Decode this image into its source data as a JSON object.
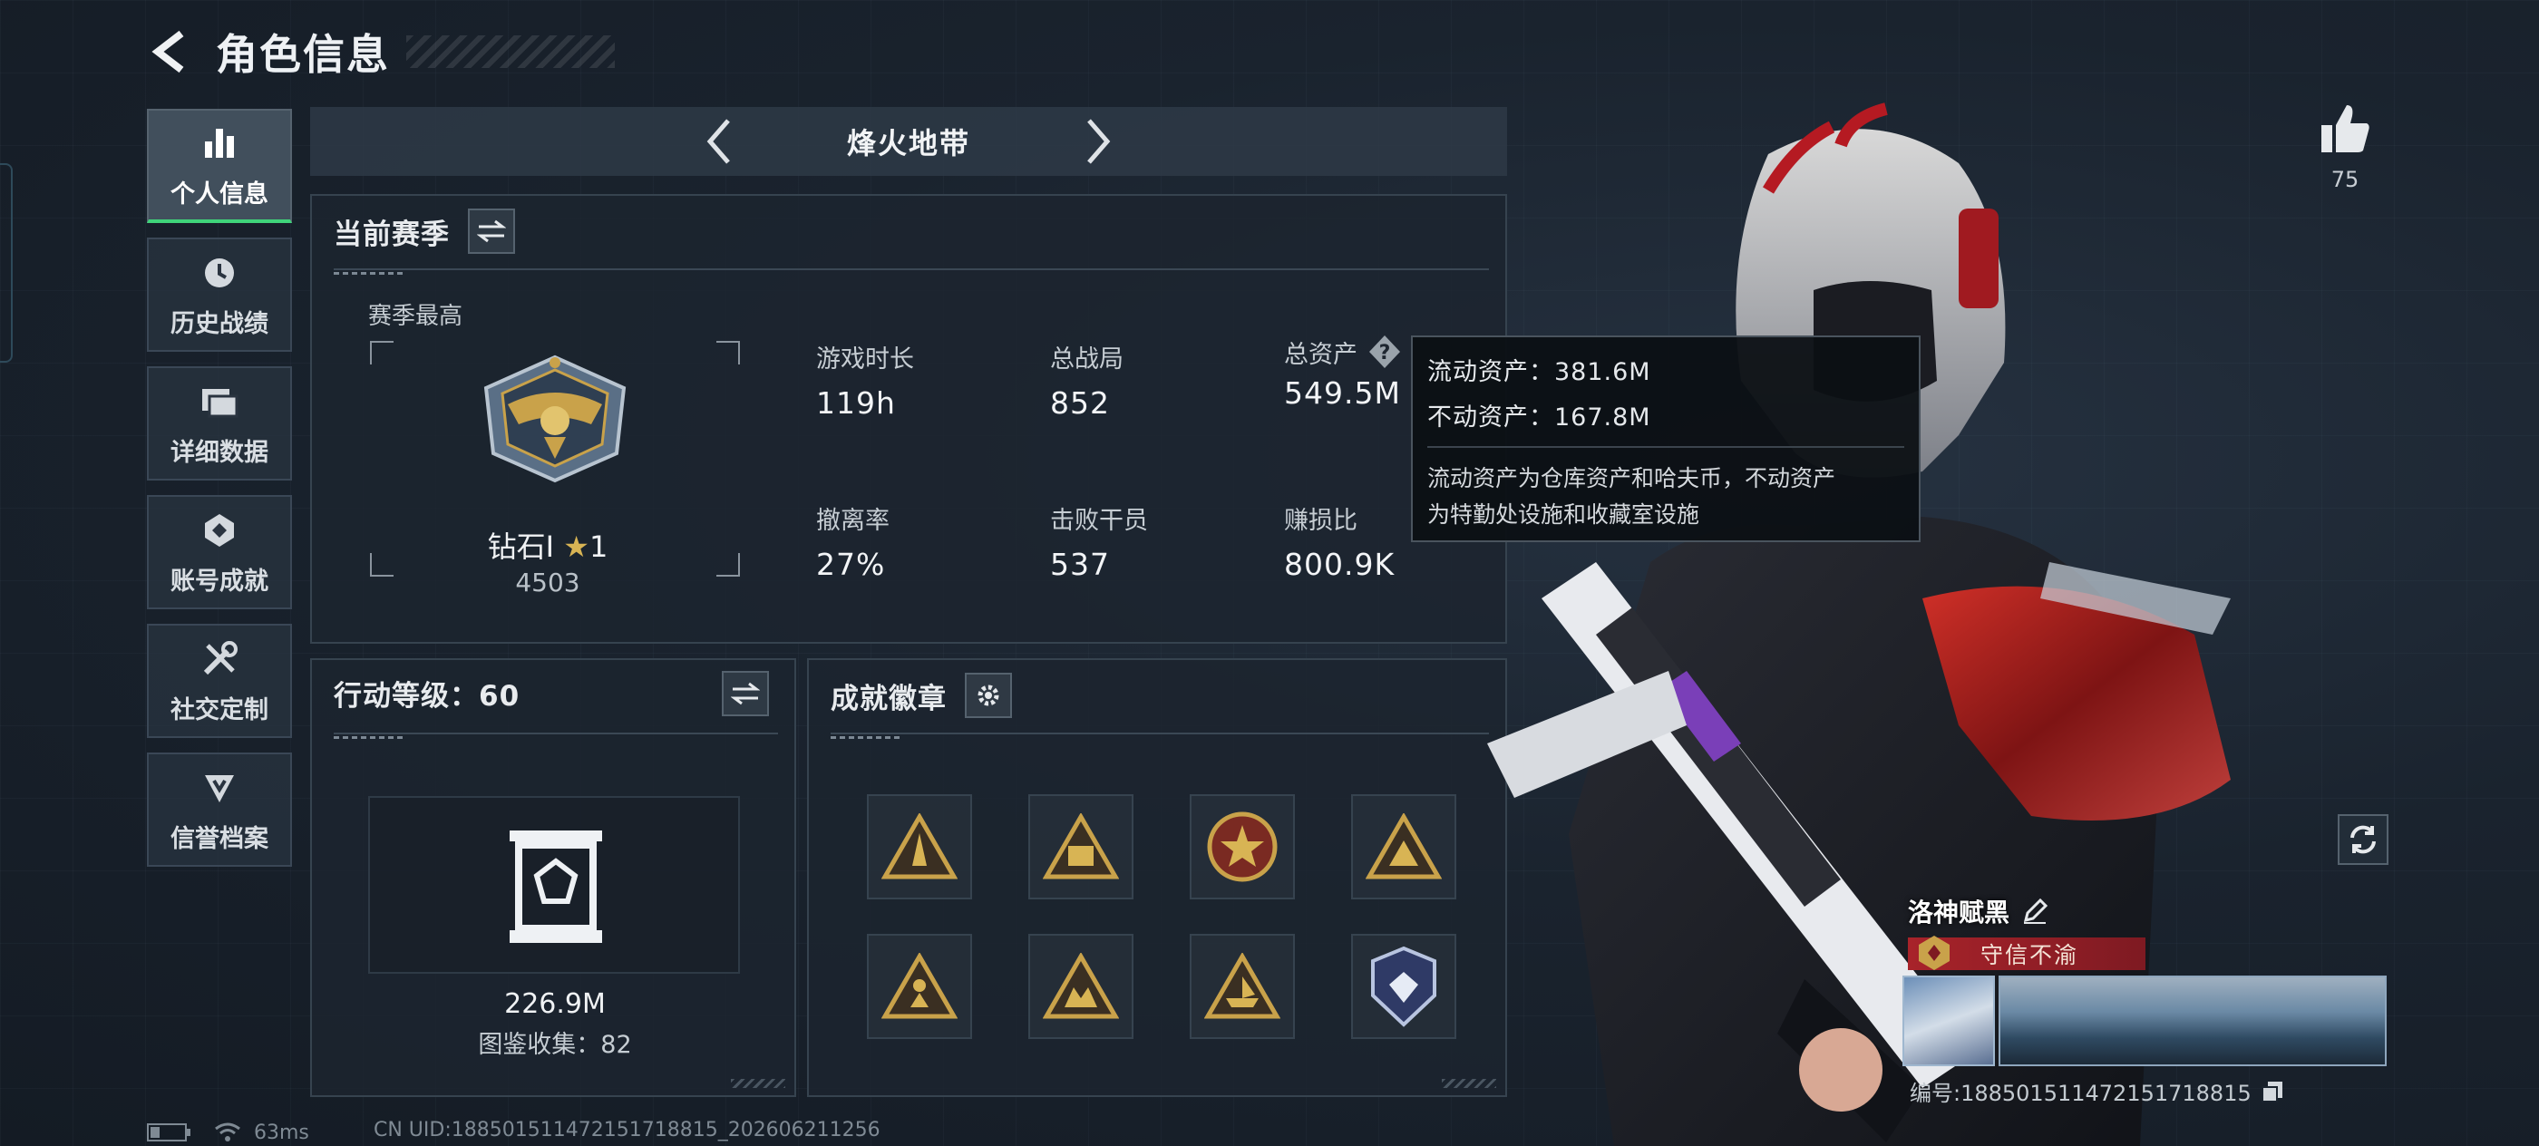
{
  "header": {
    "title": "角色信息"
  },
  "sidebar": {
    "items": [
      {
        "label": "个人信息",
        "icon": "bar-chart-icon",
        "active": true
      },
      {
        "label": "历史战绩",
        "icon": "clock-icon"
      },
      {
        "label": "详细数据",
        "icon": "folders-icon"
      },
      {
        "label": "账号成就",
        "icon": "achievement-icon"
      },
      {
        "label": "社交定制",
        "icon": "tools-icon"
      },
      {
        "label": "信誉档案",
        "icon": "credit-icon"
      }
    ]
  },
  "mode": {
    "title": "烽火地带"
  },
  "season": {
    "title": "当前赛季",
    "best_label": "赛季最高",
    "rank_name": "钻石Ⅰ",
    "rank_stars": "1",
    "rank_score": "4503",
    "stats": [
      {
        "key": "游戏时长",
        "value": "119h"
      },
      {
        "key": "总战局",
        "value": "852"
      },
      {
        "key": "总资产",
        "value": "549.5M"
      },
      {
        "key": "撤离率",
        "value": "27%"
      },
      {
        "key": "击败干员",
        "value": "537"
      },
      {
        "key": "赚损比",
        "value": "800.9K"
      }
    ]
  },
  "tooltip": {
    "liquid": "流动资产：381.6M",
    "fixed": "不动资产：167.8M",
    "desc_line1": "流动资产为仓库资产和哈夫币，不动资产",
    "desc_line2": "为特勤处设施和收藏室设施"
  },
  "level": {
    "title": "行动等级：60",
    "value": "226.9M",
    "collection": "图鉴收集：82"
  },
  "badges": {
    "title": "成就徽章",
    "items": [
      "badge-1",
      "badge-2",
      "badge-3",
      "badge-4",
      "badge-5",
      "badge-6",
      "badge-7",
      "badge-8"
    ]
  },
  "likes": {
    "count": "75"
  },
  "player": {
    "name": "洛神赋黑",
    "honor": "守信不渝",
    "id": "编号:188501511472151718815"
  },
  "status": {
    "ping": "63ms",
    "uid": "CN UID:188501511472151718815_202606211256"
  },
  "colors": {
    "accent_green": "#3fd47a",
    "honor_red": "#a8232a",
    "gold": "#c9a24a"
  }
}
